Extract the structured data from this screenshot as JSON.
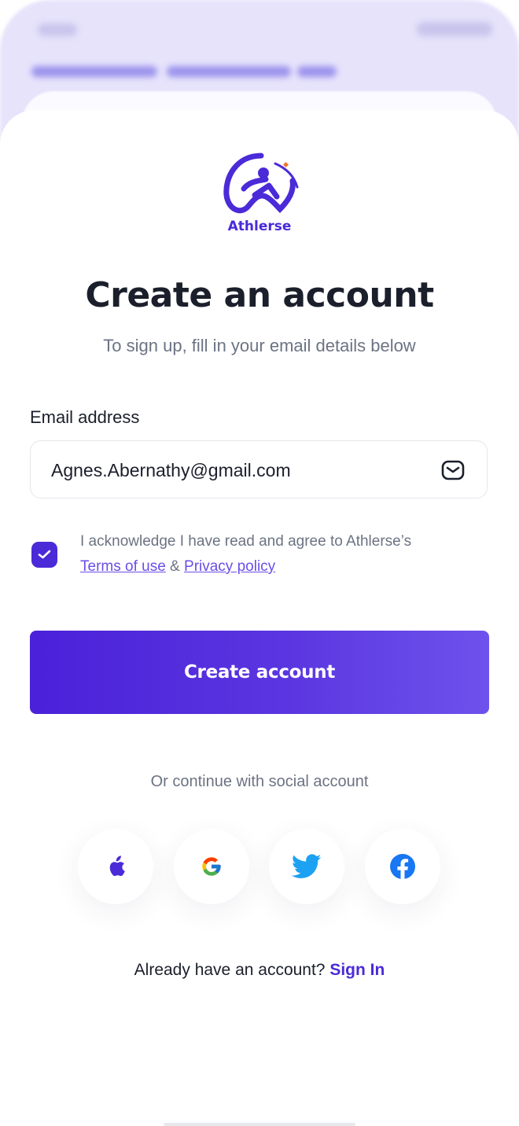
{
  "brand": {
    "name": "Athlerse",
    "accent": "#4b2ad8"
  },
  "header": {
    "title": "Create an account",
    "subtitle": "To sign up, fill in your email details below"
  },
  "email": {
    "label": "Email address",
    "value": "Agnes.Abernathy@gmail.com",
    "icon": "mail-icon"
  },
  "consent": {
    "checked": true,
    "text": "I acknowledge I have read and agree to Athlerse’s",
    "terms_label": "Terms of use",
    "separator": "&",
    "privacy_label": "Privacy policy"
  },
  "cta": {
    "label": "Create account"
  },
  "social": {
    "caption": "Or continue with social account",
    "providers": [
      "apple-icon",
      "google-icon",
      "twitter-icon",
      "facebook-icon"
    ]
  },
  "footer": {
    "prompt": "Already have an account?",
    "link_label": "Sign In"
  }
}
